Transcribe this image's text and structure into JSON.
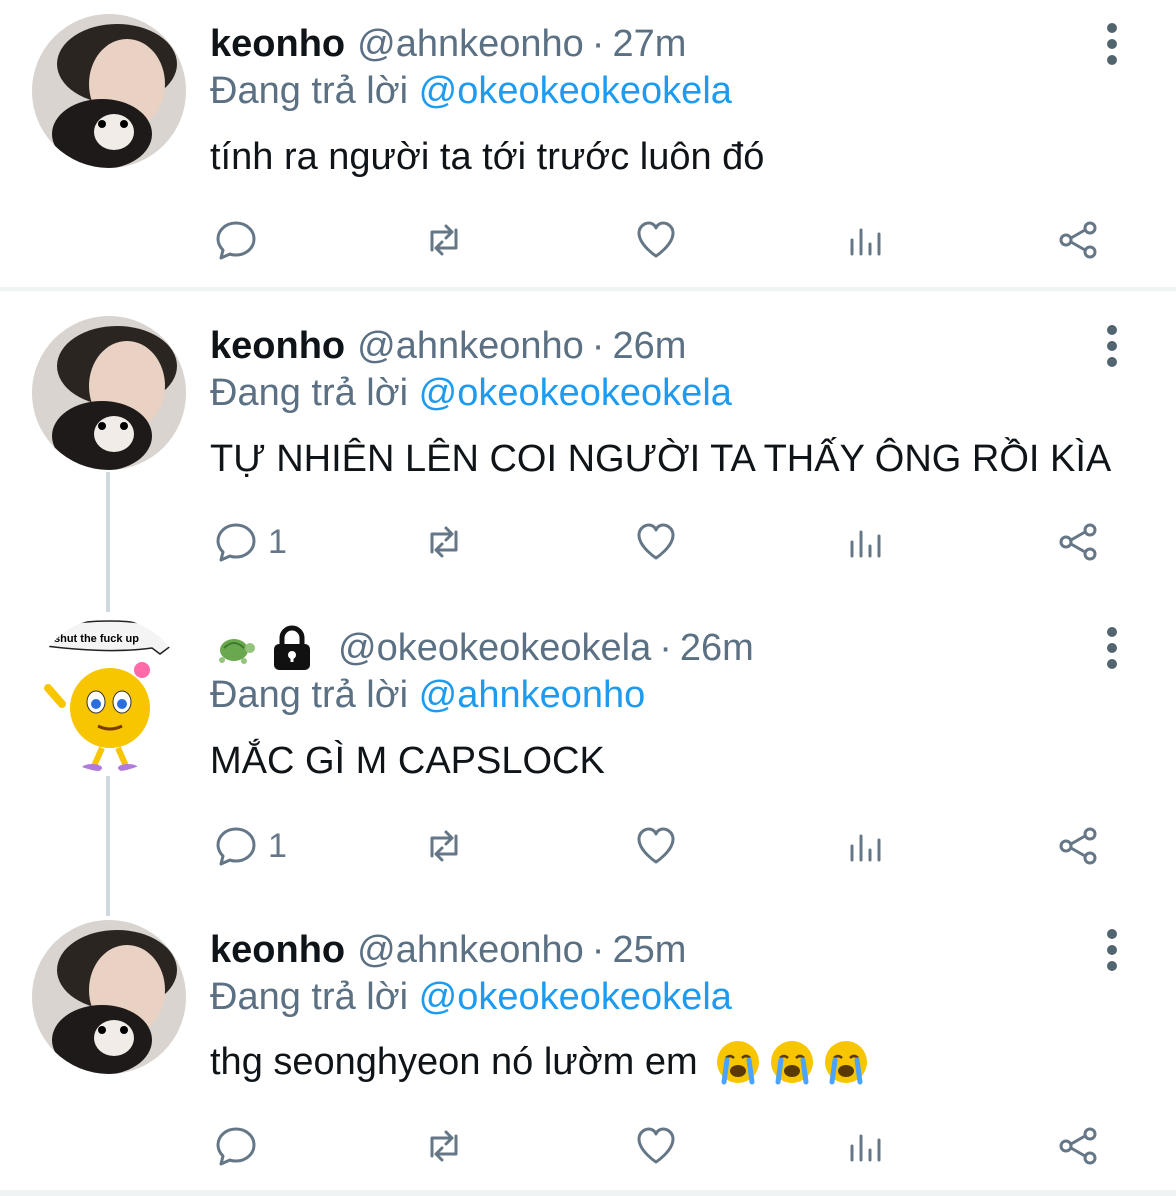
{
  "tweets": [
    {
      "name": "keonho",
      "handle": "@ahnkeonho",
      "time": "27m",
      "reply_prefix": "Đang trả lời",
      "reply_to": "@okeokeokeokela",
      "text": "tính ra người ta tới trước luôn đó",
      "reply_count": ""
    },
    {
      "name": "keonho",
      "handle": "@ahnkeonho",
      "time": "26m",
      "reply_prefix": "Đang trả lời",
      "reply_to": "@okeokeokeokela",
      "text": "TỰ NHIÊN LÊN COI NGƯỜI TA THẤY ÔNG RỒI KÌA",
      "reply_count": "1"
    },
    {
      "name": "",
      "handle": "@okeokeokeokela",
      "time": "26m",
      "reply_prefix": "Đang trả lời",
      "reply_to": "@ahnkeonho",
      "text": "MẮC GÌ M CAPSLOCK",
      "reply_count": "1",
      "avatar_caption": "shut the fuck up"
    },
    {
      "name": "keonho",
      "handle": "@ahnkeonho",
      "time": "25m",
      "reply_prefix": "Đang trả lời",
      "reply_to": "@okeokeokeokela",
      "text": "thg seonghyeon nó lườm em",
      "reply_count": ""
    }
  ],
  "separator": "·",
  "icons": {
    "reply": "reply-icon",
    "retweet": "retweet-icon",
    "like": "heart-icon",
    "views": "views-icon",
    "share": "share-icon",
    "more": "more-vertical-icon",
    "turtle": "turtle-icon",
    "lock": "lock-icon",
    "crying": "loudly-crying-face-icon"
  },
  "colors": {
    "text": "#0f1419",
    "secondary": "#5b7083",
    "mention": "#1d9bf0",
    "icon": "#657786",
    "thread_line": "#cfd9de"
  }
}
